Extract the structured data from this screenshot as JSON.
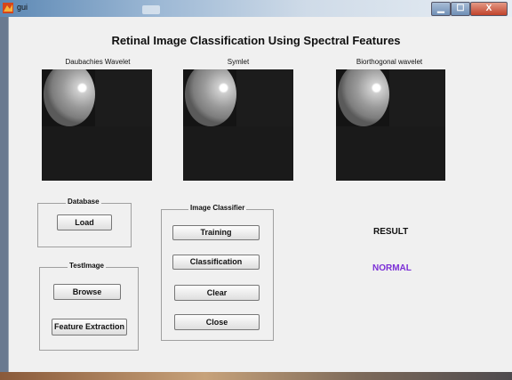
{
  "window": {
    "title": "gui",
    "controls": {
      "minimize": "▁",
      "maximize": "☐",
      "close": "X"
    }
  },
  "heading": "Retinal Image Classification Using Spectral Features",
  "images": [
    {
      "label": "Daubachies Wavelet"
    },
    {
      "label": "Symlet"
    },
    {
      "label": "Biorthogonal wavelet"
    }
  ],
  "database_group": {
    "title": "Database",
    "load_label": "Load"
  },
  "testimage_group": {
    "title": "TestImage",
    "browse_label": "Browse",
    "feature_label": "Feature Extraction"
  },
  "classifier_group": {
    "title": "Image Classifier",
    "training_label": "Training",
    "classification_label": "Classification",
    "clear_label": "Clear",
    "close_label": "Close"
  },
  "result": {
    "label": "RESULT",
    "value": "NORMAL",
    "value_color": "#7b2fd6"
  },
  "icons": {
    "app": "matlab-icon"
  }
}
